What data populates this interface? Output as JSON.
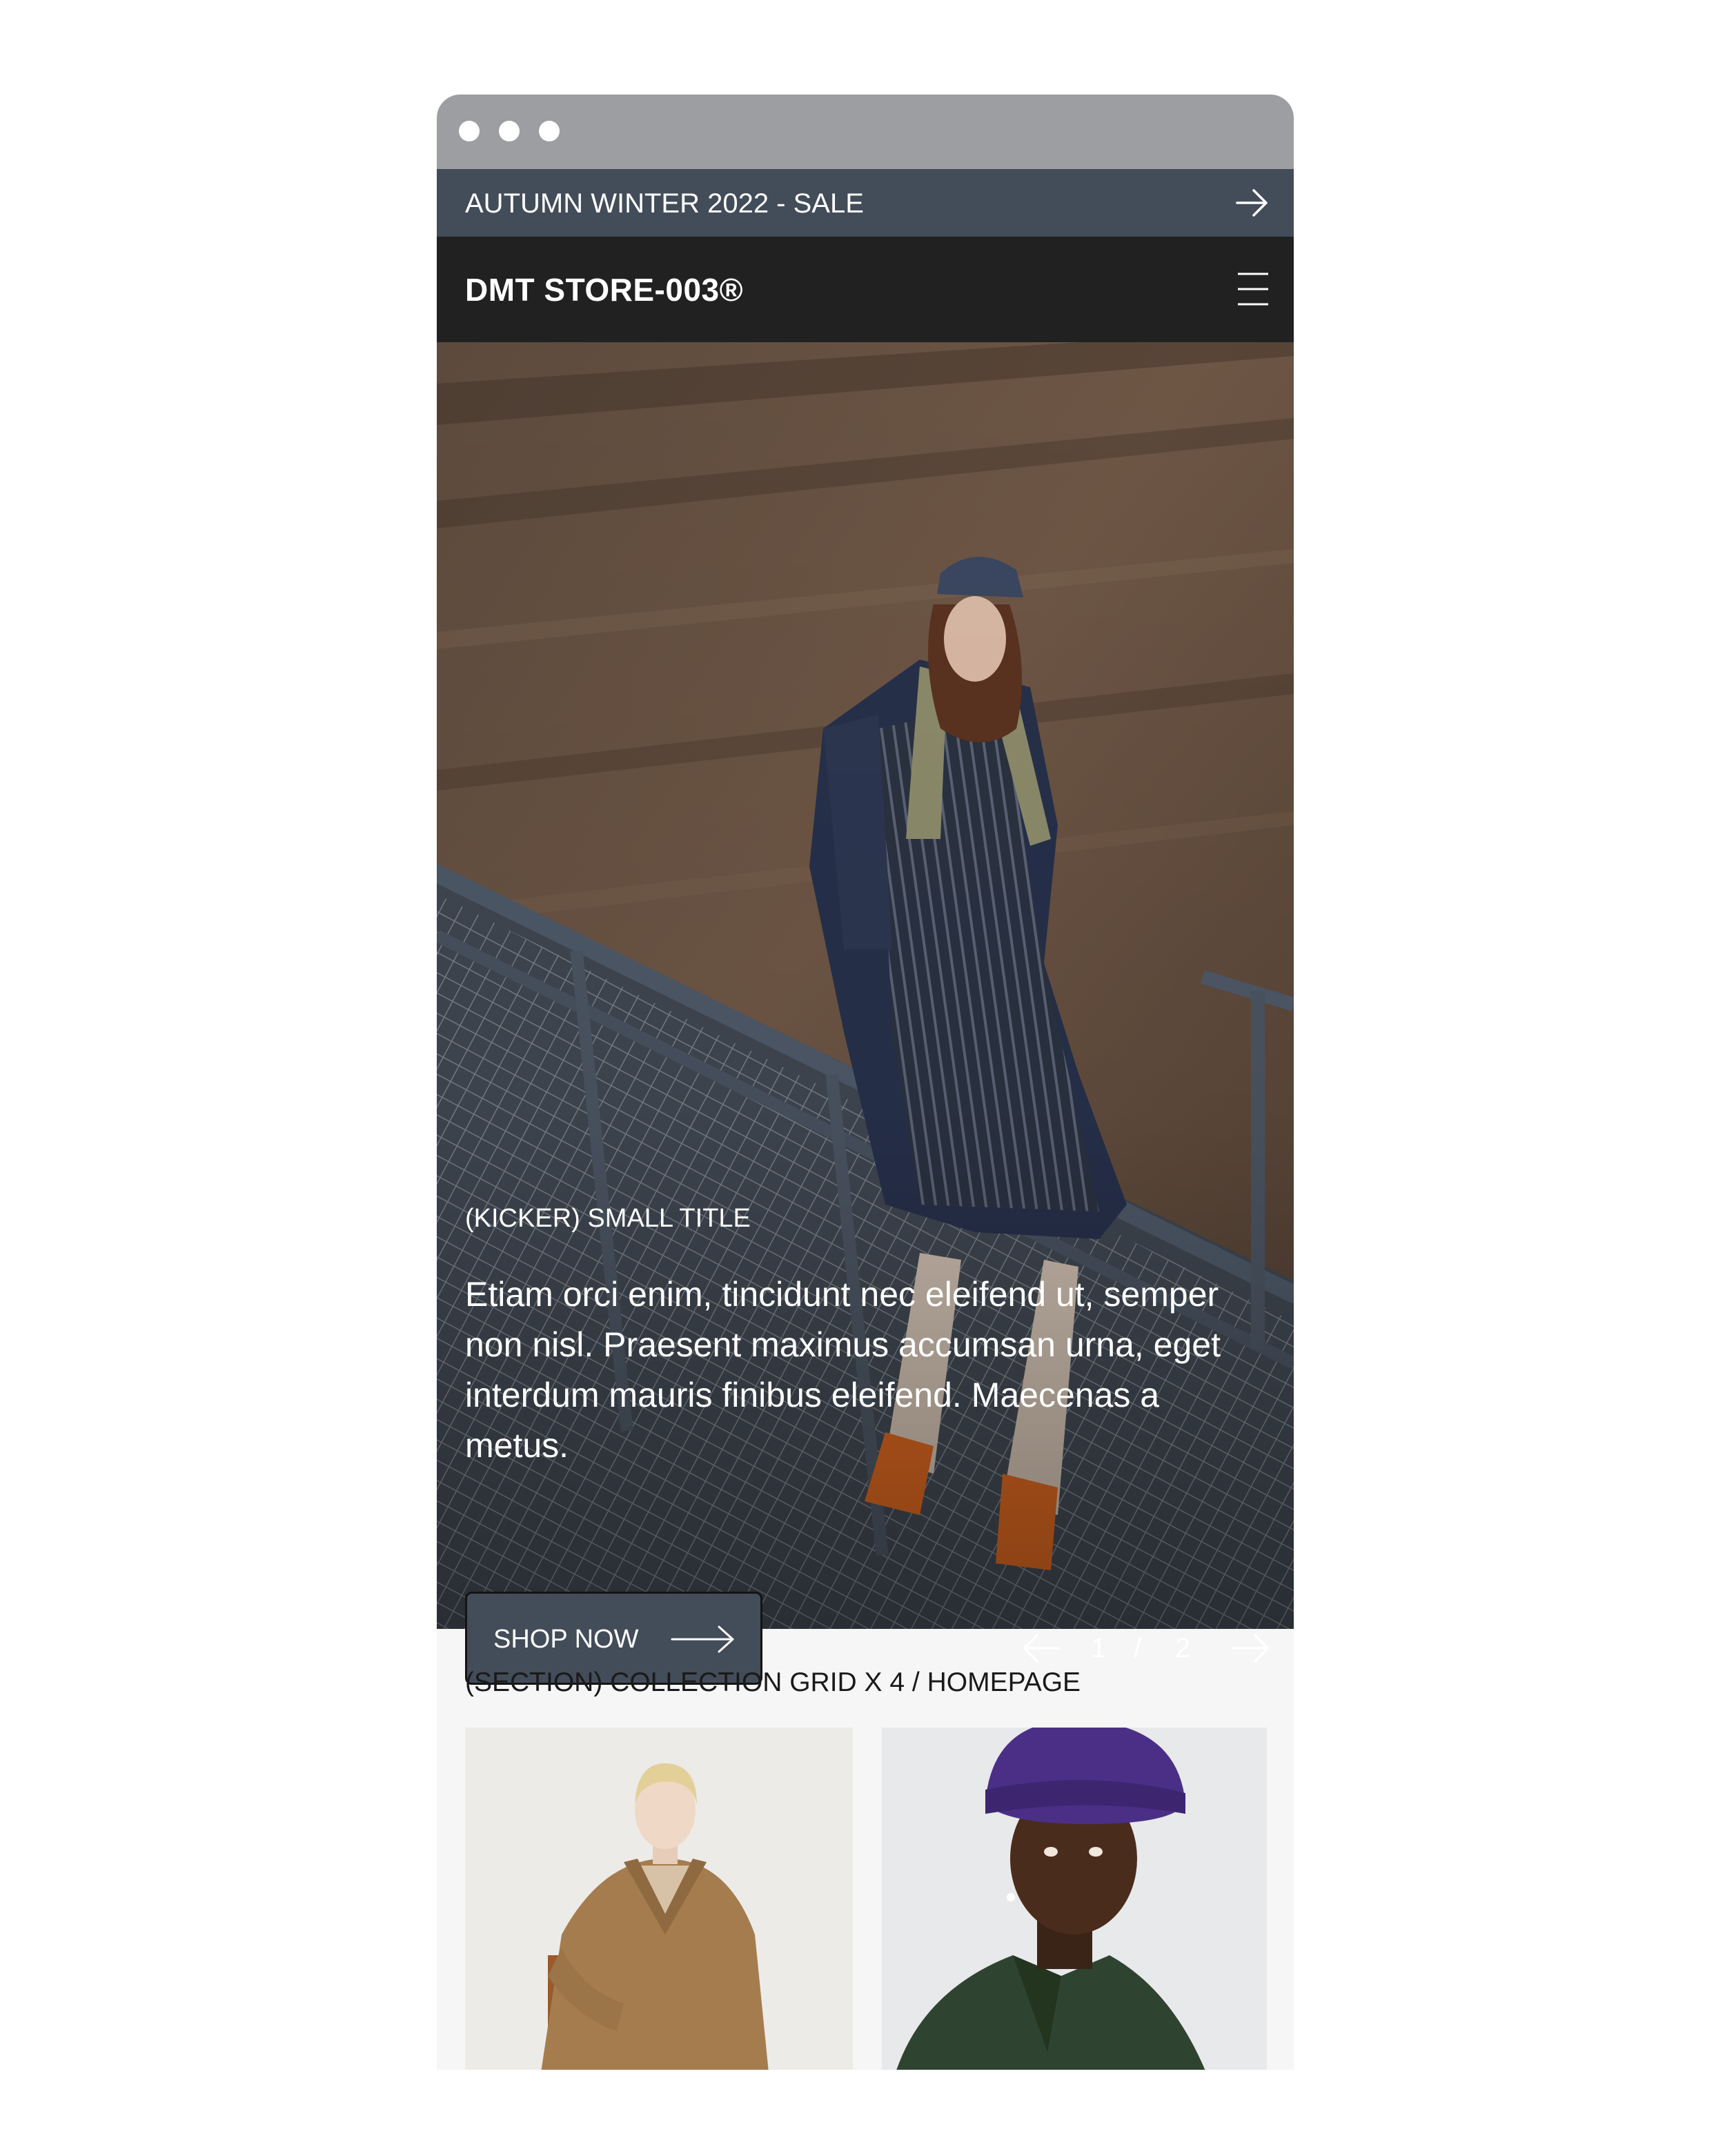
{
  "announcement": {
    "text": "AUTUMN WINTER 2022 - SALE",
    "arrow_icon": "arrow-right-icon"
  },
  "header": {
    "logo": "DMT STORE-003®",
    "menu_icon": "hamburger-menu-icon"
  },
  "hero": {
    "kicker": "(KICKER) SMALL TITLE",
    "body": "Etiam orci enim, tincidunt nec eleifend ut, semper non nisl. Praesent maximus accumsan urna, eget interdum mauris finibus eleifend. Maecenas a  metus.",
    "cta_label": "SHOP NOW",
    "cta_icon": "arrow-right-icon",
    "pager": {
      "current": "1",
      "separator": "/",
      "total": "2",
      "prev_icon": "arrow-left-icon",
      "next_icon": "arrow-right-icon"
    }
  },
  "collection": {
    "title": "(SECTION) COLLECTION GRID X 4 / HOMEPAGE"
  },
  "colors": {
    "titlebar": "#9d9ea1",
    "announcement_bg": "#434c59",
    "header_bg": "#212121",
    "button_bg": "#434c59",
    "section_bg": "#f6f6f6"
  }
}
